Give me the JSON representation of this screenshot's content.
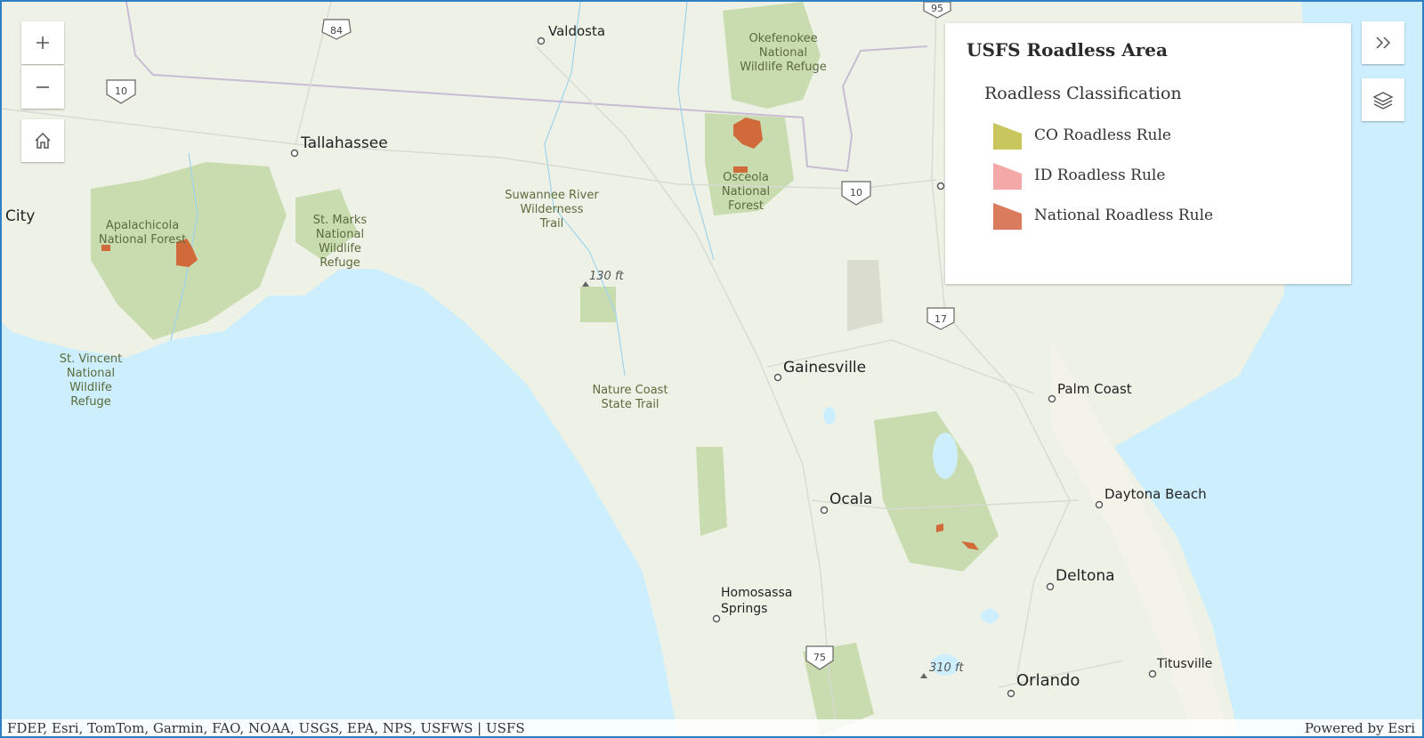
{
  "legend": {
    "title": "USFS Roadless Area",
    "subtitle": "Roadless Classification",
    "items": [
      {
        "label": "CO Roadless Rule",
        "color": "#c8c75e"
      },
      {
        "label": "ID Roadless Rule",
        "color": "#f5a8a8"
      },
      {
        "label": "National Roadless Rule",
        "color": "#d97b5c"
      }
    ]
  },
  "controls": {
    "zoom_in": "zoom-in",
    "zoom_out": "zoom-out",
    "home": "home",
    "collapse": "chevrons-right",
    "layers": "layers"
  },
  "map": {
    "cities": [
      "Valdosta",
      "Tallahassee",
      "City",
      "Gainesville",
      "Palm Coast",
      "Ocala",
      "Daytona Beach",
      "Deltona",
      "Homosassa",
      "Springs",
      "Titusville",
      "Orlando"
    ],
    "places": {
      "okefenokee": [
        "Okefenokee",
        "National",
        "Wildlife Refuge"
      ],
      "osceola": [
        "Osceola",
        "National",
        "Forest"
      ],
      "suwannee": [
        "Suwannee River",
        "Wilderness",
        "Trail"
      ],
      "st_marks": [
        "St. Marks",
        "National",
        "Wildlife",
        "Refuge"
      ],
      "apalachicola": [
        "Apalachicola",
        "National Forest"
      ],
      "st_vincent": [
        "St. Vincent",
        "National",
        "Wildlife",
        "Refuge"
      ],
      "nature_coast": [
        "Nature Coast",
        "State Trail"
      ]
    },
    "elevations": [
      "130 ft",
      "310 ft"
    ],
    "shields": [
      "84",
      "10",
      "10",
      "95",
      "17",
      "75"
    ]
  },
  "attribution": {
    "sources": "FDEP, Esri, TomTom, Garmin, FAO, NOAA, USGS, EPA, NPS, USFWS | USFS",
    "powered_by": "Powered by Esri"
  },
  "colors": {
    "water": "#cdeefd",
    "land": "#eef2e6",
    "forest": "#c9dcaf",
    "roadless": "#d06a3a"
  }
}
